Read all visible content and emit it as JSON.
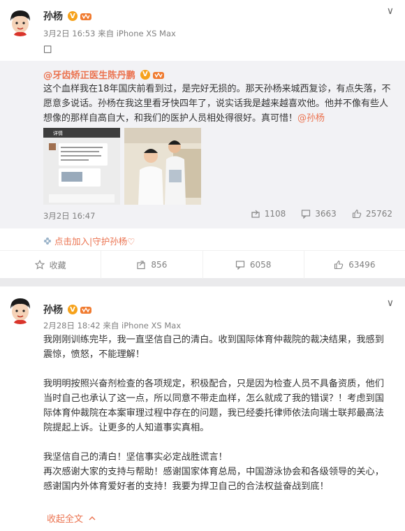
{
  "post1": {
    "author": "孙杨",
    "meta": "3月2日 16:53 来自 iPhone XS Max",
    "content": "□",
    "repost": {
      "author": "@牙齿矫正医生陈丹鹏",
      "body_text": "这个血样我在18年国庆前看到过，是完好无损的。那天孙杨来城西复诊，有点失落，不愿意多说话。孙杨在我这里看牙快四年了，说实话我是越来越喜欢他。他并不像有些人想像的那样自高自大，和我们的医护人员相处得很好。真可惜！",
      "mention": "@孙杨",
      "date": "3月2日 16:47",
      "shares": "1108",
      "comments": "3663",
      "likes": "25762",
      "thumb1_title": "详情"
    },
    "topic": "点击加入|守护孙杨♡",
    "actions": {
      "favorite": "收藏",
      "share": "856",
      "comment": "6058",
      "like": "63496"
    }
  },
  "post2": {
    "author": "孙杨",
    "meta": "2月28日 18:42 来自 iPhone XS Max",
    "paragraphs": [
      "我刚刚训练完毕，我一直坚信自己的清白。收到国际体育仲裁院的裁决结果，我感到震惊，愤怒，不能理解！",
      "",
      "我明明按照兴奋剂检查的各项规定，积极配合，只是因为检查人员不具备资质，他们当时自己也承认了这一点，所以同意不带走血样，怎么就成了我的错误？！考虑到国际体育仲裁院在本案审理过程中存在的问题，我已经委托律师依法向瑞士联邦最高法院提起上诉。让更多的人知道事实真相。",
      "",
      "我坚信自己的清白！坚信事实必定战胜谎言！",
      "再次感谢大家的支持与帮助！感谢国家体育总局，中国游泳协会和各级领导的关心，感谢国内外体育爱好者的支持！我要为捍卫自己的合法权益奋战到底！"
    ],
    "collapse": "收起全文"
  },
  "colors": {
    "accent": "#eb7350",
    "verified": "#f6a21b",
    "meta_gray": "#808080"
  }
}
